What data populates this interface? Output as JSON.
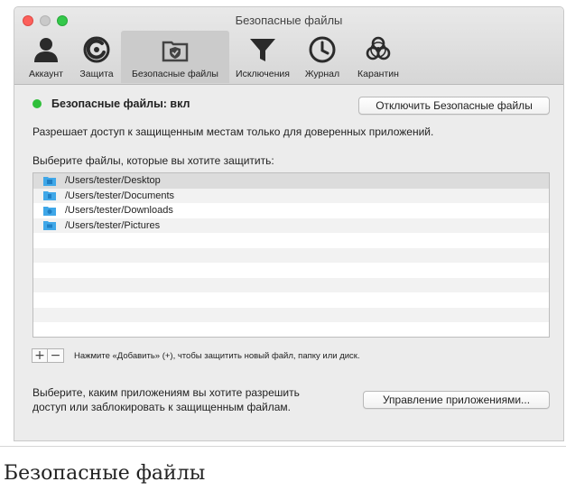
{
  "window": {
    "title": "Безопасные файлы"
  },
  "toolbar": {
    "tabs": [
      {
        "label": "Аккаунт",
        "icon": "account-icon"
      },
      {
        "label": "Защита",
        "icon": "protection-icon"
      },
      {
        "label": "Безопасные файлы",
        "icon": "safe-files-icon",
        "active": true
      },
      {
        "label": "Исключения",
        "icon": "exclusions-filter-icon"
      },
      {
        "label": "Журнал",
        "icon": "clock-icon"
      },
      {
        "label": "Карантин",
        "icon": "biohazard-icon"
      }
    ]
  },
  "status": {
    "text": "Безопасные файлы: вкл",
    "color": "#2fbf3a"
  },
  "buttons": {
    "disable": "Отключить Безопасные файлы",
    "manage_apps": "Управление приложениями...",
    "add": "+",
    "remove": "−"
  },
  "description": "Разрешает доступ к защищенным местам только для доверенных приложений.",
  "files": {
    "label": "Выберите файлы, которые вы хотите защитить:",
    "items": [
      "/Users/tester/Desktop",
      "/Users/tester/Documents",
      "/Users/tester/Downloads",
      "/Users/tester/Pictures"
    ]
  },
  "hint": "Нажмите «Добавить» (+), чтобы защитить новый файл, папку или диск.",
  "apps_text": "Выберите, каким приложениям вы хотите разрешить доступ или заблокировать к защищенным файлам.",
  "caption": "Безопасные файлы"
}
